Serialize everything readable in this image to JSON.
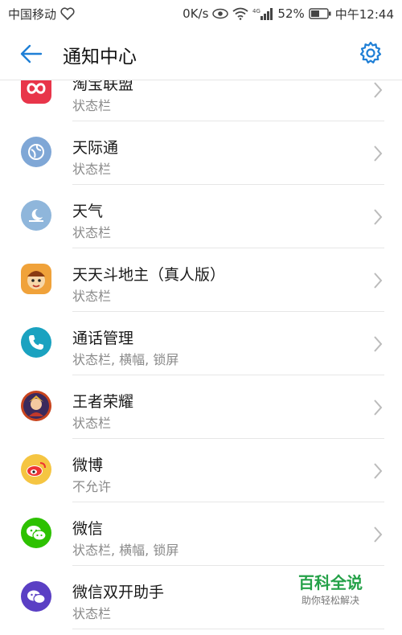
{
  "status_bar": {
    "carrier": "中国移动",
    "speed": "0K/s",
    "network": "4G",
    "battery": "52%",
    "time": "中午12:44"
  },
  "header": {
    "title": "通知中心",
    "back_icon": "arrow-left-icon",
    "settings_icon": "gear-icon"
  },
  "apps": [
    {
      "name": "淘宝联盟",
      "status": "状态栏",
      "icon": "taobao-union-icon",
      "color": "#e8354a"
    },
    {
      "name": "天际通",
      "status": "状态栏",
      "icon": "tianjitong-icon",
      "color": "#7fa7d6"
    },
    {
      "name": "天气",
      "status": "状态栏",
      "icon": "weather-icon",
      "color": "#8fb6db"
    },
    {
      "name": "天天斗地主（真人版）",
      "status": "状态栏",
      "icon": "doudizhu-icon",
      "color": "#f0a23a"
    },
    {
      "name": "通话管理",
      "status": "状态栏, 横幅, 锁屏",
      "icon": "phone-icon",
      "color": "#1aa2c0"
    },
    {
      "name": "王者荣耀",
      "status": "状态栏",
      "icon": "honor-of-kings-icon",
      "color": "#c8441e"
    },
    {
      "name": "微博",
      "status": "不允许",
      "icon": "weibo-icon",
      "color": "#f5c542"
    },
    {
      "name": "微信",
      "status": "状态栏, 横幅, 锁屏",
      "icon": "wechat-icon",
      "color": "#2dc100"
    },
    {
      "name": "微信双开助手",
      "status": "状态栏",
      "icon": "wechat-dual-icon",
      "color": "#5a3fc4"
    }
  ],
  "watermark": {
    "title": "百科全说",
    "subtitle": "助你轻松解决"
  },
  "colors": {
    "accent": "#1f7fd6"
  }
}
